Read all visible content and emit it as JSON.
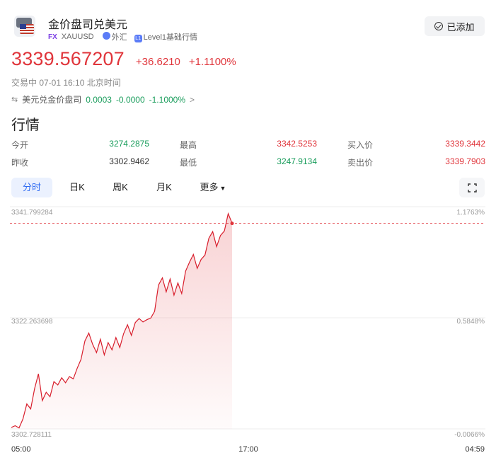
{
  "header": {
    "name": "金价盘司兑美元",
    "fx_tag": "FX",
    "code": "XAUUSD",
    "market": "外汇",
    "level_tag": "L1",
    "level": "Level1基础行情",
    "added_label": "已添加"
  },
  "price": {
    "last": "3339.567207",
    "change": "+36.6210",
    "change_pct": "+1.1100%"
  },
  "status": "交易中 07-01 16:10 北京时间",
  "related": {
    "name": "美元兑金价盘司",
    "last": "0.0003",
    "change": "-0.0000",
    "change_pct": "-1.1000%",
    "arrow": ">"
  },
  "section_title": "行情",
  "quotes": {
    "open_label": "今开",
    "open": "3274.2875",
    "high_label": "最高",
    "high": "3342.5253",
    "bid_label": "买入价",
    "bid": "3339.3442",
    "prev_label": "昨收",
    "prev": "3302.9462",
    "low_label": "最低",
    "low": "3247.9134",
    "ask_label": "卖出价",
    "ask": "3339.7903"
  },
  "tabs": [
    "分时",
    "日K",
    "周K",
    "月K",
    "更多"
  ],
  "active_tab": "分时",
  "chart_data": {
    "type": "area",
    "y_left_ticks": [
      "3341.799284",
      "3322.263698",
      "3302.728111"
    ],
    "y_right_ticks": [
      "1.1763%",
      "0.5848%",
      "-0.0066%"
    ],
    "x_ticks": [
      "05:00",
      "17:00",
      "04:59"
    ],
    "ylim": [
      3302.728111,
      3341.799284
    ],
    "reference_value": 3339.567207,
    "color": "#e0353b",
    "values": [
      3303.0,
      3303.3,
      3302.9,
      3304.5,
      3307.2,
      3306.3,
      3309.9,
      3312.6,
      3307.8,
      3309.3,
      3308.5,
      3311.2,
      3310.6,
      3311.9,
      3311.0,
      3312.1,
      3311.7,
      3313.6,
      3315.2,
      3318.5,
      3319.9,
      3317.9,
      3316.4,
      3318.8,
      3316.0,
      3318.2,
      3316.9,
      3319.1,
      3317.3,
      3319.8,
      3321.4,
      3319.5,
      3321.8,
      3322.5,
      3321.9,
      3322.3,
      3322.6,
      3323.8,
      3328.5,
      3329.8,
      3327.3,
      3329.6,
      3326.7,
      3328.9,
      3327.0,
      3331.0,
      3332.6,
      3334.0,
      3331.5,
      3333.1,
      3333.9,
      3336.9,
      3338.1,
      3335.4,
      3337.4,
      3338.2,
      3341.3,
      3339.6
    ]
  }
}
